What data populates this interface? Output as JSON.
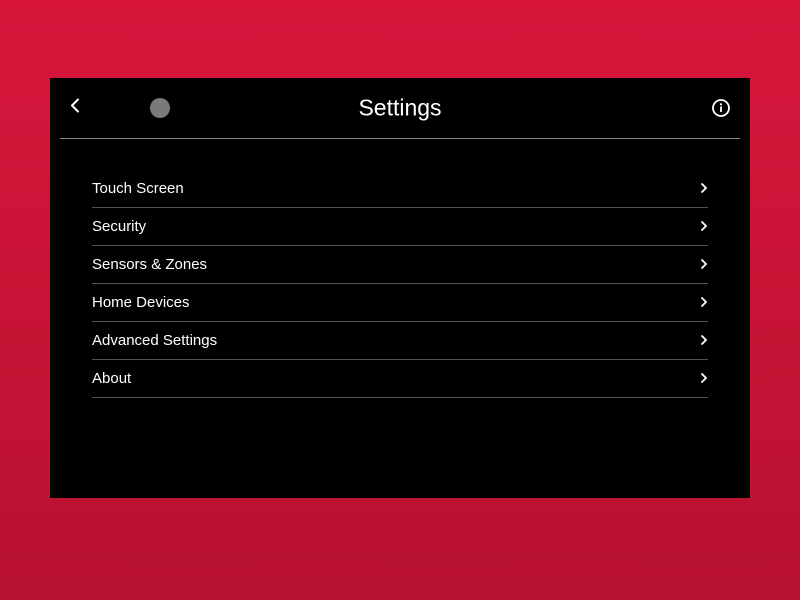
{
  "header": {
    "title": "Settings"
  },
  "menu": {
    "items": [
      {
        "label": "Touch Screen"
      },
      {
        "label": "Security"
      },
      {
        "label": "Sensors & Zones"
      },
      {
        "label": "Home Devices"
      },
      {
        "label": "Advanced Settings"
      },
      {
        "label": "About"
      }
    ]
  }
}
